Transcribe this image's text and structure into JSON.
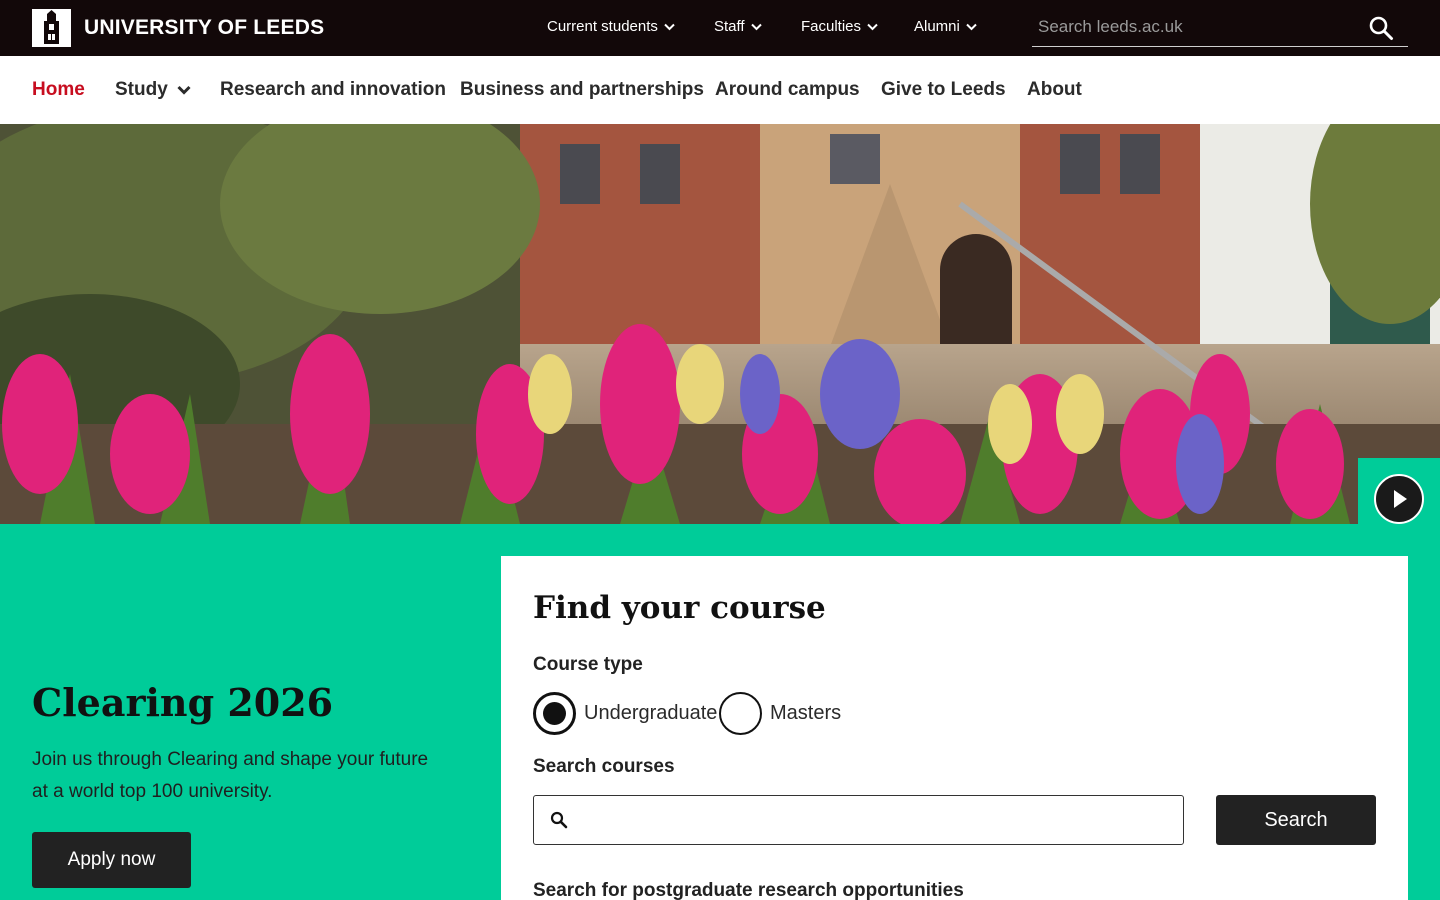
{
  "brand": {
    "logo_text": "UNIVERSITY OF LEEDS"
  },
  "utility_nav": {
    "items": [
      {
        "label": "Current students"
      },
      {
        "label": "Staff"
      },
      {
        "label": "Faculties"
      },
      {
        "label": "Alumni"
      }
    ],
    "search": {
      "placeholder": "Search leeds.ac.uk",
      "icon": "search-icon"
    }
  },
  "main_nav": {
    "items": [
      {
        "label": "Home",
        "active": true
      },
      {
        "label": "Study",
        "has_dropdown": true
      },
      {
        "label": "Research and innovation"
      },
      {
        "label": "Business and partnerships"
      },
      {
        "label": "Around campus"
      },
      {
        "label": "Give to Leeds"
      },
      {
        "label": "About"
      }
    ],
    "active_color": "#c70d1f"
  },
  "hero": {
    "play_icon": "play-icon"
  },
  "clearing": {
    "title": "Clearing 2026",
    "text": "Join us through Clearing and shape your future at a world top 100 university.",
    "button_label": "Apply now"
  },
  "course_finder": {
    "title": "Find your course",
    "course_type_label": "Course type",
    "options": [
      {
        "label": "Undergraduate",
        "selected": true
      },
      {
        "label": "Masters",
        "selected": false
      }
    ],
    "search_label": "Search courses",
    "input_value": "",
    "search_button_label": "Search",
    "pg_research_link": "Search for postgraduate research opportunities"
  },
  "colors": {
    "topbar": "#120809",
    "accent_green": "#00cc99",
    "button_dark": "#222222"
  }
}
